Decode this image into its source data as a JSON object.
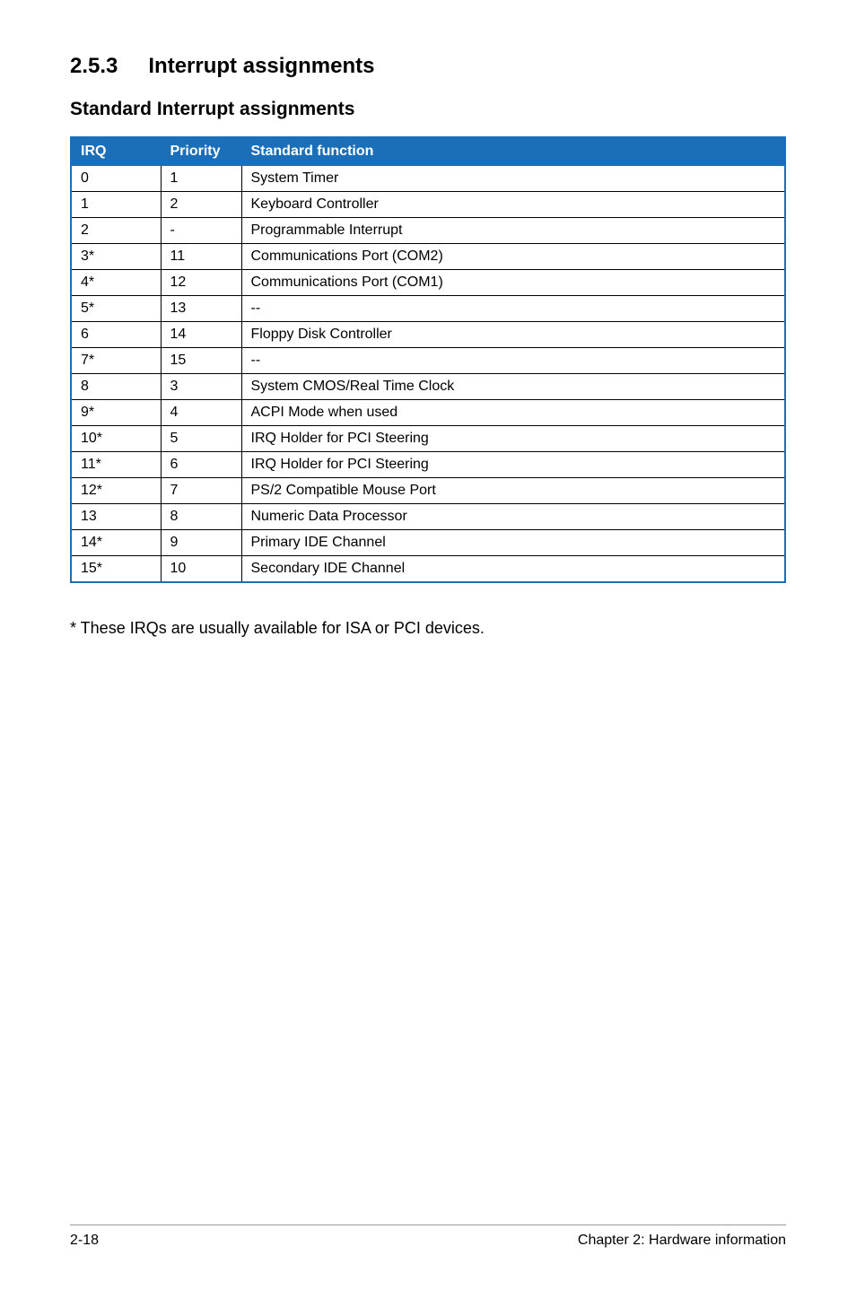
{
  "section": {
    "number": "2.5.3",
    "title": "Interrupt assignments"
  },
  "subheading": "Standard Interrupt assignments",
  "table": {
    "headers": {
      "irq": "IRQ",
      "priority": "Priority",
      "function": "Standard function"
    },
    "rows": [
      {
        "irq": "0",
        "priority": "1",
        "function": "System Timer"
      },
      {
        "irq": "1",
        "priority": "2",
        "function": "Keyboard Controller"
      },
      {
        "irq": "2",
        "priority": "-",
        "function": "Programmable Interrupt"
      },
      {
        "irq": "3*",
        "priority": "11",
        "function": "Communications Port (COM2)"
      },
      {
        "irq": "4*",
        "priority": "12",
        "function": "Communications Port (COM1)"
      },
      {
        "irq": "5*",
        "priority": "13",
        "function": "--"
      },
      {
        "irq": "6",
        "priority": "14",
        "function": "Floppy Disk Controller"
      },
      {
        "irq": "7*",
        "priority": "15",
        "function": "--"
      },
      {
        "irq": "8",
        "priority": "3",
        "function": "System CMOS/Real Time Clock"
      },
      {
        "irq": "9*",
        "priority": "4",
        "function": "ACPI Mode when used"
      },
      {
        "irq": "10*",
        "priority": "5",
        "function": "IRQ Holder for PCI Steering"
      },
      {
        "irq": "11*",
        "priority": "6",
        "function": "IRQ Holder for PCI Steering"
      },
      {
        "irq": "12*",
        "priority": "7",
        "function": "PS/2 Compatible Mouse Port"
      },
      {
        "irq": "13",
        "priority": "8",
        "function": "Numeric Data Processor"
      },
      {
        "irq": "14*",
        "priority": "9",
        "function": "Primary IDE Channel"
      },
      {
        "irq": "15*",
        "priority": "10",
        "function": "Secondary IDE Channel"
      }
    ]
  },
  "footnote": "* These IRQs are usually available for ISA or PCI devices.",
  "footer": {
    "left": "2-18",
    "right": "Chapter 2: Hardware information"
  }
}
